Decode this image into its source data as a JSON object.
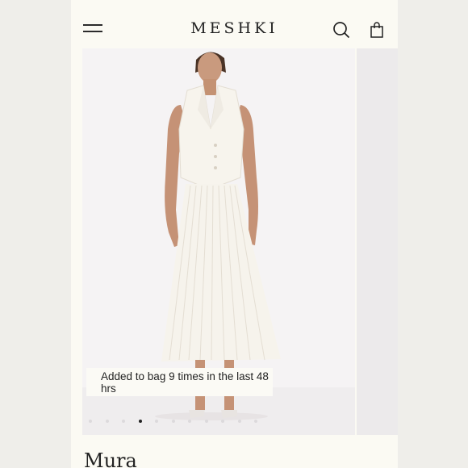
{
  "header": {
    "brand": "MESHKI",
    "icons": {
      "menu": "hamburger-menu-icon",
      "search": "search-icon",
      "bag": "shopping-bag-icon"
    }
  },
  "gallery": {
    "badge_text": "Added to bag 9 times in the last 48 hrs",
    "image_count": 11,
    "active_index": 3
  },
  "product": {
    "title": "Mura"
  },
  "colors": {
    "background": "#fbfaf3",
    "text": "#222222",
    "image_background": "#f5f3f4",
    "garment": "#f6f3ec"
  }
}
